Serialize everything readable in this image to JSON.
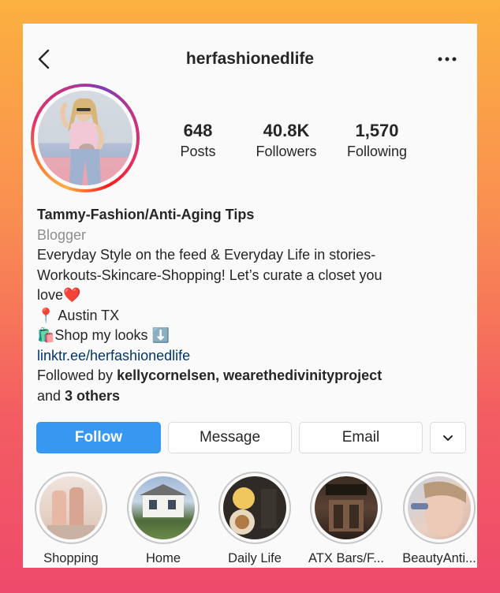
{
  "header": {
    "username": "herfashionedlife"
  },
  "stats": [
    {
      "value": "648",
      "label": "Posts"
    },
    {
      "value": "40.8K",
      "label": "Followers"
    },
    {
      "value": "1,570",
      "label": "Following"
    }
  ],
  "bio": {
    "name": "Tammy-Fashion/Anti-Aging Tips",
    "category": "Blogger",
    "line1": "Everyday Style on the feed & Everyday Life in stories-",
    "line2": "Workouts-Skincare-Shopping! Let’s curate a closet you",
    "line3": "love",
    "line3_emoji": "❤️",
    "location_emoji": "📍",
    "location": " Austin TX",
    "shop_emoji": "🛍️",
    "shop": "Shop my looks ",
    "shop_arrow": "⬇️",
    "link": "linktr.ee/herfashionedlife",
    "followed_prefix": "Followed by ",
    "followed_names": "kellycornelsen, wearethedivinityproject",
    "followed_and": "and ",
    "followed_others": "3 others"
  },
  "buttons": {
    "follow": "Follow",
    "message": "Message",
    "email": "Email"
  },
  "highlights": [
    {
      "label": "Shopping"
    },
    {
      "label": "Home"
    },
    {
      "label": "Daily Life"
    },
    {
      "label": "ATX Bars/F..."
    },
    {
      "label": "BeautyAnti..."
    }
  ],
  "colors": {
    "follow_button": "#3897f0",
    "link": "#00376b",
    "secondary_text": "#8e8e8e"
  },
  "icons": {
    "back": "chevron-left-icon",
    "more": "more-horizontal-icon",
    "dropdown": "chevron-down-icon"
  }
}
